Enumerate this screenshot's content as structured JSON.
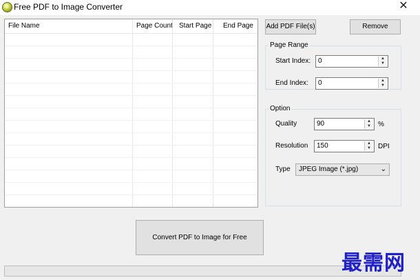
{
  "window": {
    "title": "Free PDF to Image Converter",
    "close_glyph": "✕"
  },
  "file_list": {
    "columns": [
      "File Name",
      "Page Count",
      "Start Page",
      "End Page"
    ],
    "rows": []
  },
  "buttons": {
    "add_pdf": "Add PDF File(s)",
    "remove": "Remove",
    "convert": "Convert PDF to Image for Free"
  },
  "page_range": {
    "group_label": "Page Range",
    "start_label": "Start Index:",
    "start_value": "0",
    "end_label": "End Index:",
    "end_value": "0"
  },
  "option": {
    "group_label": "Option",
    "quality_label": "Quality",
    "quality_value": "90",
    "quality_unit": "%",
    "resolution_label": "Resolution",
    "resolution_value": "150",
    "resolution_unit": "DPI",
    "type_label": "Type",
    "type_value": "JPEG Image (*.jpg)"
  },
  "spinner": {
    "up": "▲",
    "down": "▼"
  },
  "combo_arrow": "⌄",
  "watermark": "最需网",
  "colors": {
    "window_bg": "#f0f0f0",
    "button_bg": "#e1e1e1",
    "watermark": "#2020c8"
  }
}
